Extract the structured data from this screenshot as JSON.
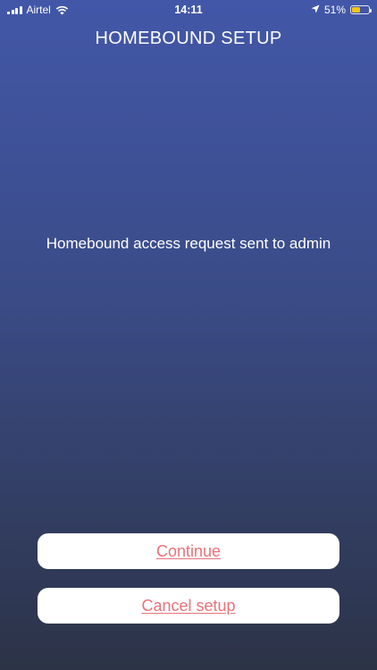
{
  "status_bar": {
    "carrier": "Airtel",
    "time": "14:11",
    "battery_percent": "51%",
    "battery_level": 0.51,
    "icons": [
      "signal-icon",
      "wifi-icon",
      "location-arrow-icon",
      "battery-icon"
    ]
  },
  "header": {
    "title": "HOMEBOUND SETUP"
  },
  "main": {
    "message": "Homebound access request sent to admin"
  },
  "actions": {
    "continue_label": "Continue",
    "cancel_label": "Cancel setup"
  },
  "colors": {
    "background_top": "#4257a8",
    "background_bottom": "#2c3347",
    "button_bg": "#ffffff",
    "button_text": "#e8737a",
    "battery_fill": "#f5c518"
  }
}
